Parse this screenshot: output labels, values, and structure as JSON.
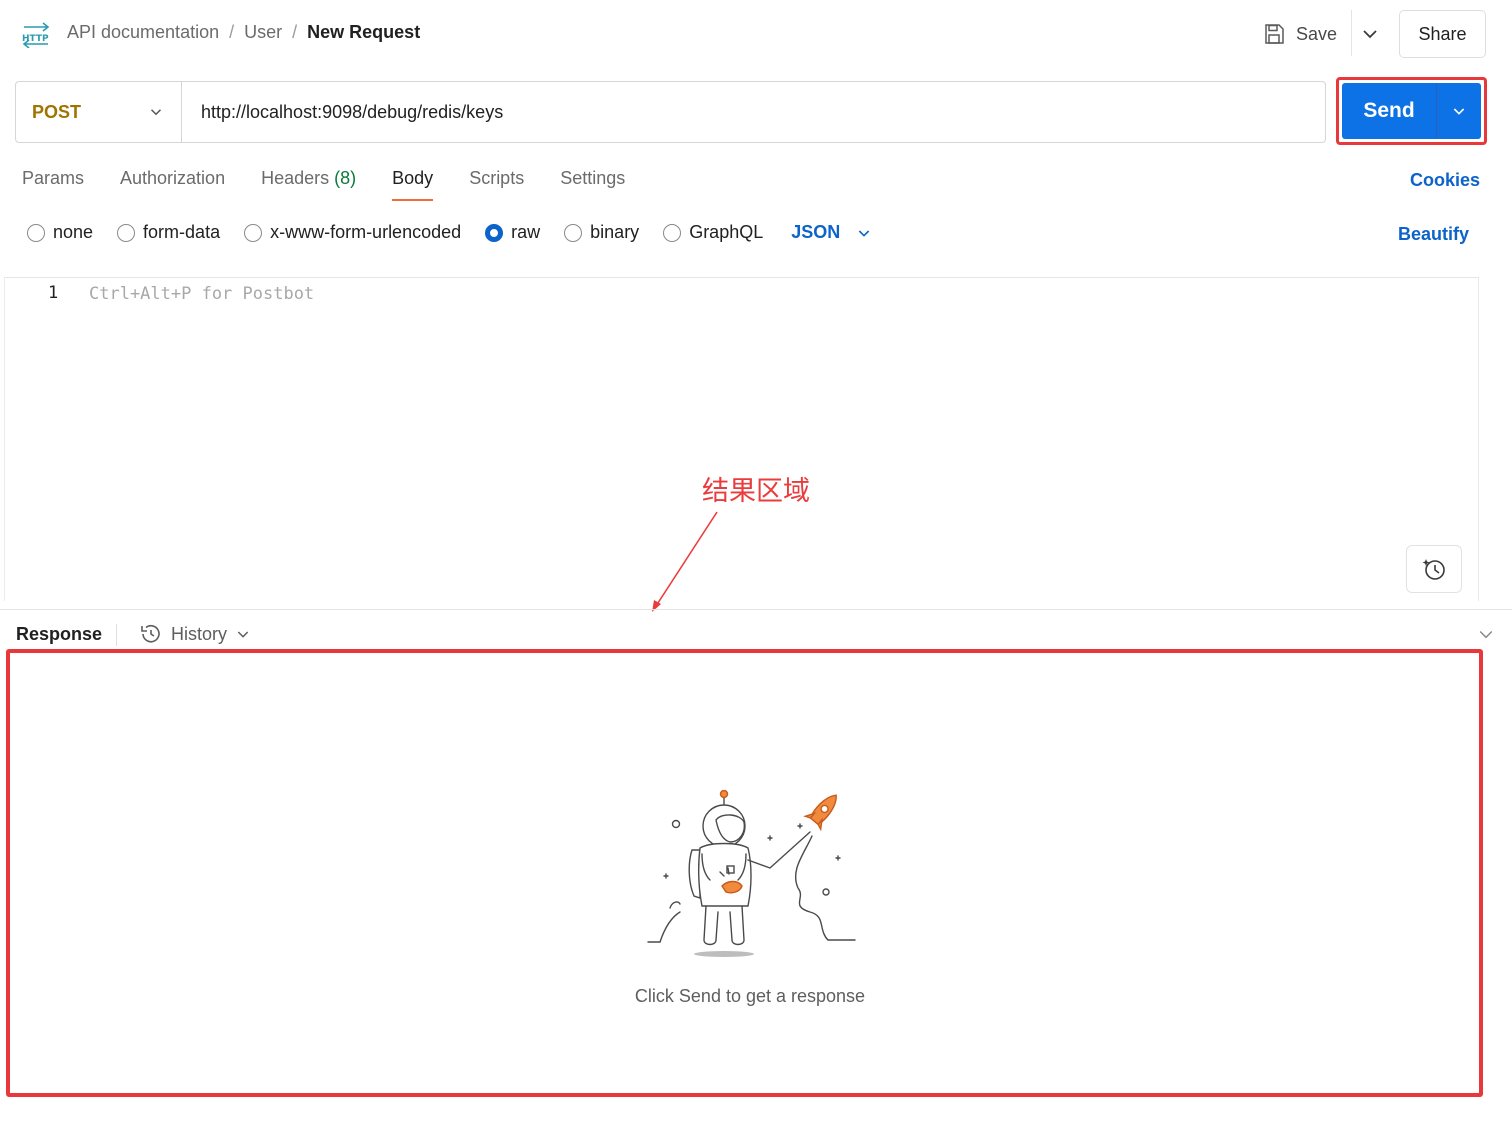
{
  "breadcrumb": {
    "items": [
      "API documentation",
      "User"
    ],
    "separator": "/",
    "current": "New Request"
  },
  "header": {
    "save_label": "Save",
    "share_label": "Share"
  },
  "request": {
    "method": "POST",
    "url": "http://localhost:9098/debug/redis/keys",
    "send_label": "Send"
  },
  "tabs": [
    {
      "label": "Params"
    },
    {
      "label": "Authorization"
    },
    {
      "label": "Headers",
      "count": "(8)"
    },
    {
      "label": "Body",
      "active": true
    },
    {
      "label": "Scripts"
    },
    {
      "label": "Settings"
    }
  ],
  "cookies_label": "Cookies",
  "body_types": {
    "options": [
      "none",
      "form-data",
      "x-www-form-urlencoded",
      "raw",
      "binary",
      "GraphQL"
    ],
    "selected": "raw",
    "format": "JSON",
    "beautify_label": "Beautify"
  },
  "editor": {
    "line_number": "1",
    "placeholder": "Ctrl+Alt+P for Postbot"
  },
  "annotation": {
    "label": "结果区域",
    "color": "#ea3c3c"
  },
  "response": {
    "title": "Response",
    "history_label": "History",
    "empty_message": "Click Send to get a response"
  },
  "colors": {
    "accent_blue": "#0c72e6",
    "method_post": "#a07400",
    "tab_underline": "#f26b3a",
    "highlight_red": "#e8383b",
    "headers_count": "#0c7a3a"
  }
}
